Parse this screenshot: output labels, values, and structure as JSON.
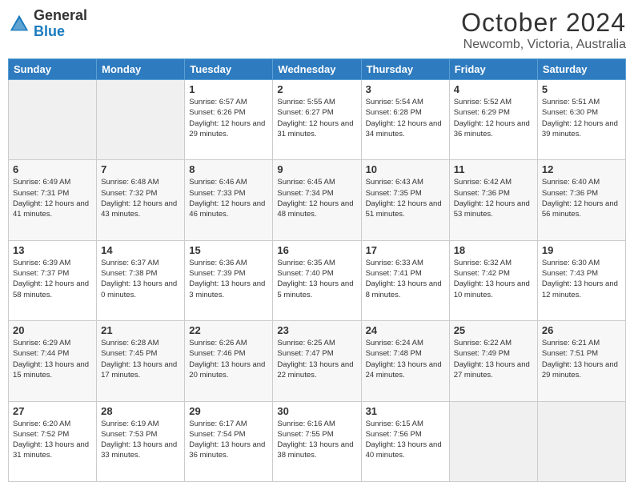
{
  "logo": {
    "general": "General",
    "blue": "Blue"
  },
  "header": {
    "month": "October 2024",
    "location": "Newcomb, Victoria, Australia"
  },
  "weekdays": [
    "Sunday",
    "Monday",
    "Tuesday",
    "Wednesday",
    "Thursday",
    "Friday",
    "Saturday"
  ],
  "weeks": [
    [
      null,
      null,
      {
        "day": 1,
        "sunrise": "6:57 AM",
        "sunset": "6:26 PM",
        "daylight": "12 hours and 29 minutes."
      },
      {
        "day": 2,
        "sunrise": "5:55 AM",
        "sunset": "6:27 PM",
        "daylight": "12 hours and 31 minutes."
      },
      {
        "day": 3,
        "sunrise": "5:54 AM",
        "sunset": "6:28 PM",
        "daylight": "12 hours and 34 minutes."
      },
      {
        "day": 4,
        "sunrise": "5:52 AM",
        "sunset": "6:29 PM",
        "daylight": "12 hours and 36 minutes."
      },
      {
        "day": 5,
        "sunrise": "5:51 AM",
        "sunset": "6:30 PM",
        "daylight": "12 hours and 39 minutes."
      }
    ],
    [
      {
        "day": 6,
        "sunrise": "6:49 AM",
        "sunset": "7:31 PM",
        "daylight": "12 hours and 41 minutes."
      },
      {
        "day": 7,
        "sunrise": "6:48 AM",
        "sunset": "7:32 PM",
        "daylight": "12 hours and 43 minutes."
      },
      {
        "day": 8,
        "sunrise": "6:46 AM",
        "sunset": "7:33 PM",
        "daylight": "12 hours and 46 minutes."
      },
      {
        "day": 9,
        "sunrise": "6:45 AM",
        "sunset": "7:34 PM",
        "daylight": "12 hours and 48 minutes."
      },
      {
        "day": 10,
        "sunrise": "6:43 AM",
        "sunset": "7:35 PM",
        "daylight": "12 hours and 51 minutes."
      },
      {
        "day": 11,
        "sunrise": "6:42 AM",
        "sunset": "7:36 PM",
        "daylight": "12 hours and 53 minutes."
      },
      {
        "day": 12,
        "sunrise": "6:40 AM",
        "sunset": "7:36 PM",
        "daylight": "12 hours and 56 minutes."
      }
    ],
    [
      {
        "day": 13,
        "sunrise": "6:39 AM",
        "sunset": "7:37 PM",
        "daylight": "12 hours and 58 minutes."
      },
      {
        "day": 14,
        "sunrise": "6:37 AM",
        "sunset": "7:38 PM",
        "daylight": "13 hours and 0 minutes."
      },
      {
        "day": 15,
        "sunrise": "6:36 AM",
        "sunset": "7:39 PM",
        "daylight": "13 hours and 3 minutes."
      },
      {
        "day": 16,
        "sunrise": "6:35 AM",
        "sunset": "7:40 PM",
        "daylight": "13 hours and 5 minutes."
      },
      {
        "day": 17,
        "sunrise": "6:33 AM",
        "sunset": "7:41 PM",
        "daylight": "13 hours and 8 minutes."
      },
      {
        "day": 18,
        "sunrise": "6:32 AM",
        "sunset": "7:42 PM",
        "daylight": "13 hours and 10 minutes."
      },
      {
        "day": 19,
        "sunrise": "6:30 AM",
        "sunset": "7:43 PM",
        "daylight": "13 hours and 12 minutes."
      }
    ],
    [
      {
        "day": 20,
        "sunrise": "6:29 AM",
        "sunset": "7:44 PM",
        "daylight": "13 hours and 15 minutes."
      },
      {
        "day": 21,
        "sunrise": "6:28 AM",
        "sunset": "7:45 PM",
        "daylight": "13 hours and 17 minutes."
      },
      {
        "day": 22,
        "sunrise": "6:26 AM",
        "sunset": "7:46 PM",
        "daylight": "13 hours and 20 minutes."
      },
      {
        "day": 23,
        "sunrise": "6:25 AM",
        "sunset": "7:47 PM",
        "daylight": "13 hours and 22 minutes."
      },
      {
        "day": 24,
        "sunrise": "6:24 AM",
        "sunset": "7:48 PM",
        "daylight": "13 hours and 24 minutes."
      },
      {
        "day": 25,
        "sunrise": "6:22 AM",
        "sunset": "7:49 PM",
        "daylight": "13 hours and 27 minutes."
      },
      {
        "day": 26,
        "sunrise": "6:21 AM",
        "sunset": "7:51 PM",
        "daylight": "13 hours and 29 minutes."
      }
    ],
    [
      {
        "day": 27,
        "sunrise": "6:20 AM",
        "sunset": "7:52 PM",
        "daylight": "13 hours and 31 minutes."
      },
      {
        "day": 28,
        "sunrise": "6:19 AM",
        "sunset": "7:53 PM",
        "daylight": "13 hours and 33 minutes."
      },
      {
        "day": 29,
        "sunrise": "6:17 AM",
        "sunset": "7:54 PM",
        "daylight": "13 hours and 36 minutes."
      },
      {
        "day": 30,
        "sunrise": "6:16 AM",
        "sunset": "7:55 PM",
        "daylight": "13 hours and 38 minutes."
      },
      {
        "day": 31,
        "sunrise": "6:15 AM",
        "sunset": "7:56 PM",
        "daylight": "13 hours and 40 minutes."
      },
      null,
      null
    ]
  ]
}
